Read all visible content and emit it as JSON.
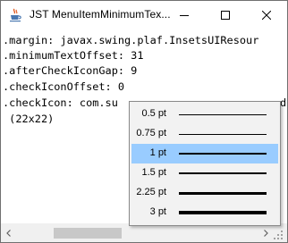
{
  "window": {
    "title": "JST MenuItemMinimumTex..."
  },
  "content": {
    "lines": [
      ".margin: javax.swing.plaf.InsetsUIResour",
      ".minimumTextOffset: 31",
      ".afterCheckIconGap: 9",
      ".checkIconOffset: 0",
      ".checkIcon: com.su",
      " (22x22)"
    ],
    "overflow_char": "d"
  },
  "popup_menu": {
    "selected_index": 2,
    "items": [
      {
        "label": "0.5 pt"
      },
      {
        "label": "0.75 pt"
      },
      {
        "label": "1 pt"
      },
      {
        "label": "1.5 pt"
      },
      {
        "label": "2.25 pt"
      },
      {
        "label": "3 pt"
      }
    ]
  },
  "icons": {
    "app": "java-cup-icon",
    "minimize": "minimize-icon",
    "maximize": "maximize-icon",
    "close": "close-icon",
    "scroll_left": "scroll-left-icon",
    "scroll_right": "scroll-right-icon",
    "resize": "resize-grip-icon"
  },
  "colors": {
    "selection": "#99ccff",
    "menu_background": "#f2f2f2",
    "scrollbar_thumb": "#c8c8c8"
  }
}
